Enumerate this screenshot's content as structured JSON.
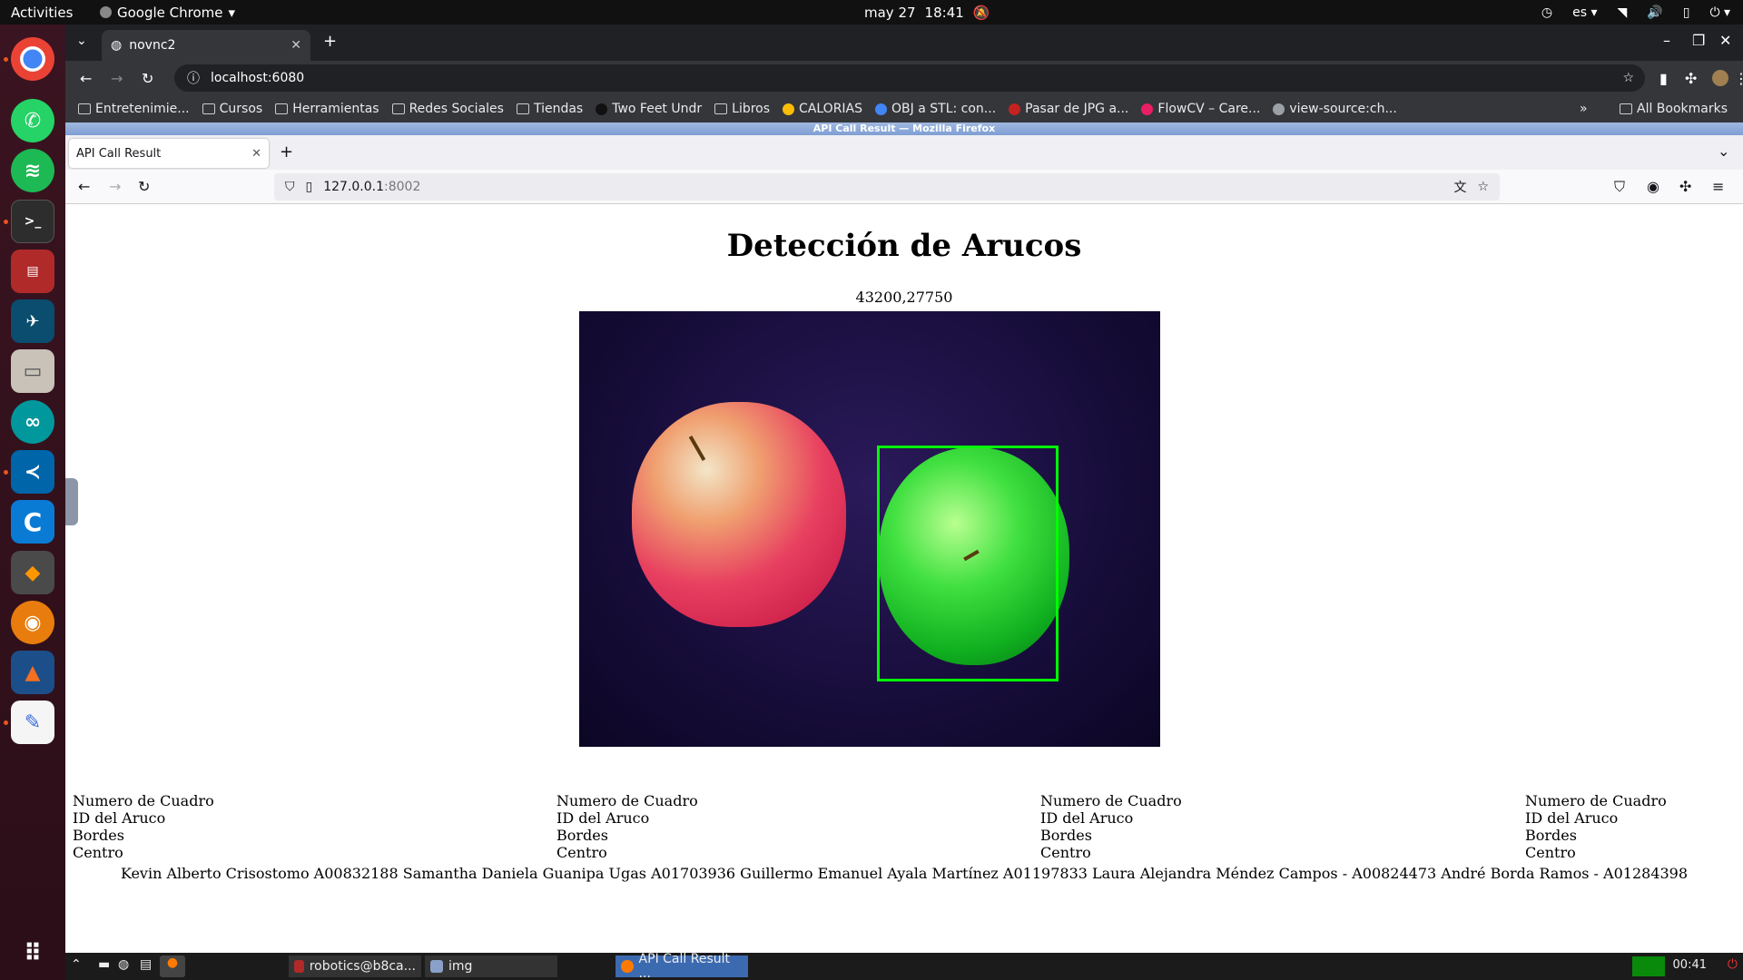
{
  "gnome": {
    "activities": "Activities",
    "app_name": "Google Chrome",
    "date": "may 27",
    "time": "18:41",
    "lang": "es"
  },
  "dock": {
    "items": [
      "chrome",
      "whatsapp",
      "spotify",
      "terminal",
      "app-red",
      "app-azure",
      "files",
      "arduino",
      "vscode",
      "app-c",
      "sublime",
      "blender",
      "matlab",
      "text-editor",
      "app-grid"
    ]
  },
  "chrome": {
    "tab_title": "novnc2",
    "url": "localhost:6080",
    "bookmarks": [
      {
        "label": "Entretenimie...",
        "type": "folder"
      },
      {
        "label": "Cursos",
        "type": "folder"
      },
      {
        "label": "Herramientas",
        "type": "folder"
      },
      {
        "label": "Redes Sociales",
        "type": "folder"
      },
      {
        "label": "Tiendas",
        "type": "folder"
      },
      {
        "label": "Two Feet Undr",
        "type": "site"
      },
      {
        "label": "Libros",
        "type": "folder"
      },
      {
        "label": "CALORIAS",
        "type": "site"
      },
      {
        "label": "OBJ a STL: con...",
        "type": "site"
      },
      {
        "label": "Pasar de JPG a...",
        "type": "site"
      },
      {
        "label": "FlowCV – Care...",
        "type": "site"
      },
      {
        "label": "view-source:ch...",
        "type": "site"
      }
    ],
    "all_bookmarks": "All Bookmarks"
  },
  "firefox": {
    "window_title": "API Call Result — Mozilla Firefox",
    "tab_title": "API Call Result",
    "url_host": "127.0.0.1",
    "url_port": ":8002"
  },
  "page": {
    "heading": "Detección de Arucos",
    "coords": "43200,27750",
    "info_columns": [
      {
        "line1": "Numero de Cuadro",
        "line2": "ID del Aruco",
        "line3": "Bordes",
        "line4": "Centro"
      },
      {
        "line1": "Numero de Cuadro",
        "line2": "ID del Aruco",
        "line3": "Bordes",
        "line4": "Centro"
      },
      {
        "line1": "Numero de Cuadro",
        "line2": "ID del Aruco",
        "line3": "Bordes",
        "line4": "Centro"
      },
      {
        "line1": "Numero de Cuadro",
        "line2": "ID del Aruco",
        "line3": "Bordes",
        "line4": "Centro"
      }
    ],
    "credits": "Kevin Alberto Crisostomo A00832188 Samantha Daniela Guanipa Ugas A01703936 Guillermo Emanuel Ayala Martínez A01197833 Laura Alejandra Méndez Campos - A00824473 André Borda Ramos - A01284398"
  },
  "lxbar": {
    "task1": "robotics@b8ca...",
    "task2": "img",
    "task3": "API Call Result ...",
    "clock": "00:41"
  },
  "colors": {
    "bbox": "#00ff00",
    "ubuntu_accent": "#e95420"
  }
}
